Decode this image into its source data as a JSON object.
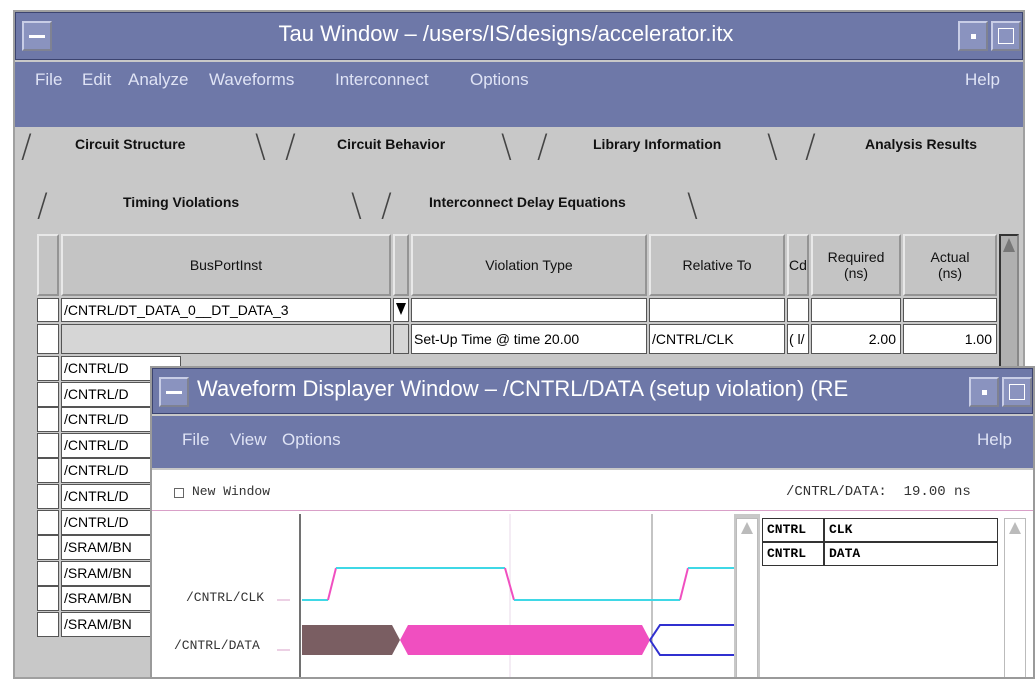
{
  "main_window": {
    "title": "Tau Window – /users/IS/designs/accelerator.itx",
    "menu": [
      "File",
      "Edit",
      "Analyze",
      "Waveforms",
      "Interconnect",
      "Options"
    ],
    "help": "Help",
    "tabs": [
      "Circuit Structure",
      "Circuit Behavior",
      "Library Information",
      "Analysis Results"
    ],
    "subtabs": [
      "Timing Violations",
      "Interconnect Delay Equations"
    ],
    "table": {
      "columns": [
        "BusPortInst",
        "Violation Type",
        "Relative To",
        "Cd",
        "Required (ns)",
        "Actual (ns)"
      ],
      "row1": {
        "busportinst": "/CNTRL/DT_DATA_0__DT_DATA_3"
      },
      "row2": {
        "violation": "Set-Up Time @ time 20.00",
        "relative": "/CNTRL/CLK",
        "cd": "( l/",
        "required": "2.00",
        "actual": "1.00"
      },
      "truncated_rows": [
        "/CNTRL/D",
        "/CNTRL/D",
        "/CNTRL/D",
        "/CNTRL/D",
        "/CNTRL/D",
        "/CNTRL/D",
        "/CNTRL/D",
        "/SRAM/BN",
        "/SRAM/BN",
        "/SRAM/BN",
        "/SRAM/BN"
      ]
    }
  },
  "waveform_window": {
    "title": "Waveform Displayer Window – /CNTRL/DATA (setup violation) (RE",
    "menu": [
      "File",
      "View",
      "Options"
    ],
    "help": "Help",
    "new_window_label": "New Window",
    "cursor_readout": "/CNTRL/DATA:  19.00 ns",
    "signals": [
      "/CNTRL/CLK",
      "/CNTRL/DATA"
    ],
    "signal_table": [
      {
        "module": "CNTRL",
        "signal": "CLK"
      },
      {
        "module": "CNTRL",
        "signal": "DATA"
      }
    ],
    "colors": {
      "clk": "#3fd8e6",
      "data_fill": "#f04fc0",
      "data_early": "#7a5e62",
      "data_after": "#3030d0"
    }
  }
}
